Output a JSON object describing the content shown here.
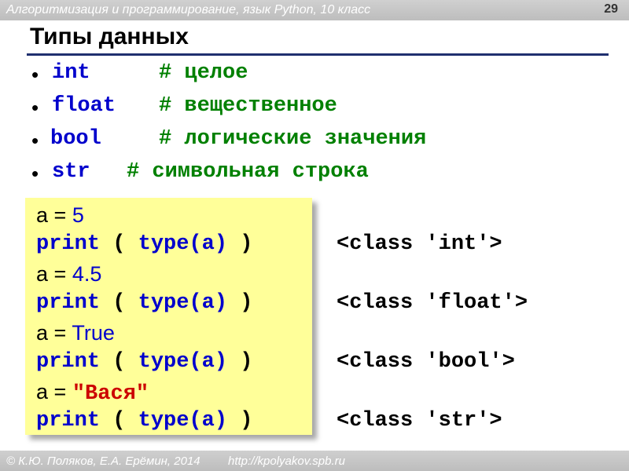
{
  "header": {
    "course": "Алгоритмизация и программирование, язык Python, 10 класс",
    "page_number": "29"
  },
  "slide": {
    "title": "Типы данных",
    "bullets": [
      {
        "type": "int",
        "comment": "# целое"
      },
      {
        "type": "float",
        "comment": "# вещественное"
      },
      {
        "type": "bool",
        "comment": "# логические значения"
      },
      {
        "type": "str",
        "comment": "# символьная строка"
      }
    ],
    "code": {
      "var": "a",
      "assign_op": "=",
      "values": [
        "5",
        "4.5",
        "True",
        "\"Вася\""
      ],
      "print_kw": "print",
      "open_paren": "(",
      "type_call": "type(a)",
      "close_paren": ")"
    },
    "outputs": [
      "<class 'int'>",
      "<class 'float'>",
      "<class 'bool'>",
      "<class 'str'>"
    ]
  },
  "footer": {
    "copyright": "© К.Ю. Поляков, Е.А. Ерёмин, 2014",
    "url": "http://kpolyakov.spb.ru"
  },
  "colors": {
    "keyword": "#0000cc",
    "comment": "#008000",
    "string": "#cc0000",
    "code_background": "#ffff99",
    "rule": "#1f2f6f"
  }
}
